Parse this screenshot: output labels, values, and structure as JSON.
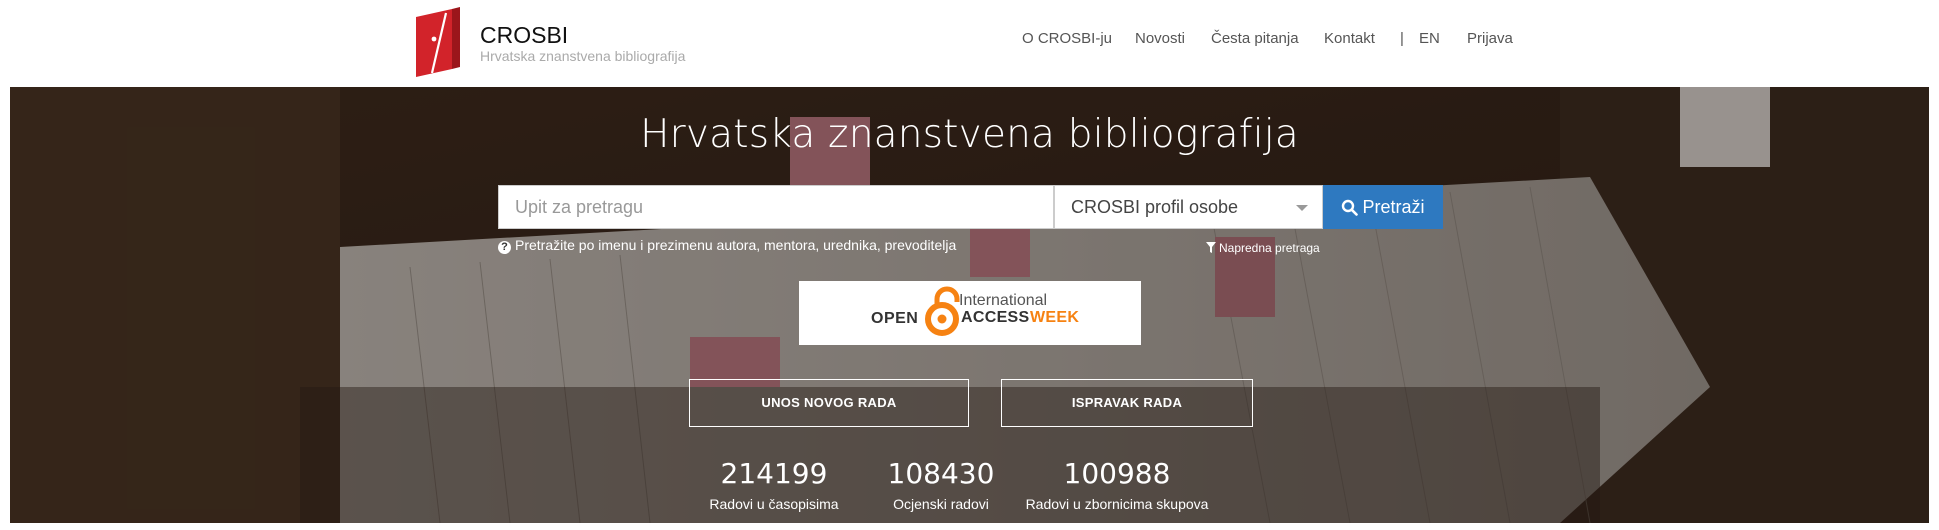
{
  "header": {
    "brand_name": "CROSBI",
    "brand_subtitle": "Hrvatska znanstvena bibliografija",
    "nav": [
      {
        "label": "O CROSBI-ju"
      },
      {
        "label": "Novosti"
      },
      {
        "label": "Česta pitanja"
      },
      {
        "label": "Kontakt"
      },
      {
        "label": "EN"
      },
      {
        "label": "Prijava"
      }
    ],
    "separator": "|"
  },
  "hero": {
    "title": "Hrvatska znanstvena bibliografija",
    "search": {
      "placeholder": "Upit za pretragu",
      "value": "",
      "select_value": "CROSBI profil osobe",
      "button_label": "Pretraži"
    },
    "help_text": "Pretražite po imenu i prezimenu autora, mentora, urednika, prevoditelja",
    "advanced_search_label": "Napredna pretraga",
    "banner": {
      "line1": "International",
      "open": "OPEN",
      "access": "ACCESS",
      "week": "WEEK"
    },
    "actions": {
      "new_entry": "UNOS NOVOG RADA",
      "correction": "ISPRAVAK RADA"
    },
    "stats": [
      {
        "value": "214199",
        "label": "Radovi u časopisima"
      },
      {
        "value": "108430",
        "label": "Ocjenski radovi"
      },
      {
        "value": "100988",
        "label": "Radovi u zbornicima skupova"
      }
    ]
  },
  "colors": {
    "brand_red": "#d2232a",
    "button_blue": "#2e79c0",
    "oa_orange": "#f68212"
  },
  "icons": [
    "crosbi-logo",
    "search-icon",
    "question-icon",
    "filter-icon",
    "open-access-lock-icon",
    "chevron-down-icon"
  ]
}
